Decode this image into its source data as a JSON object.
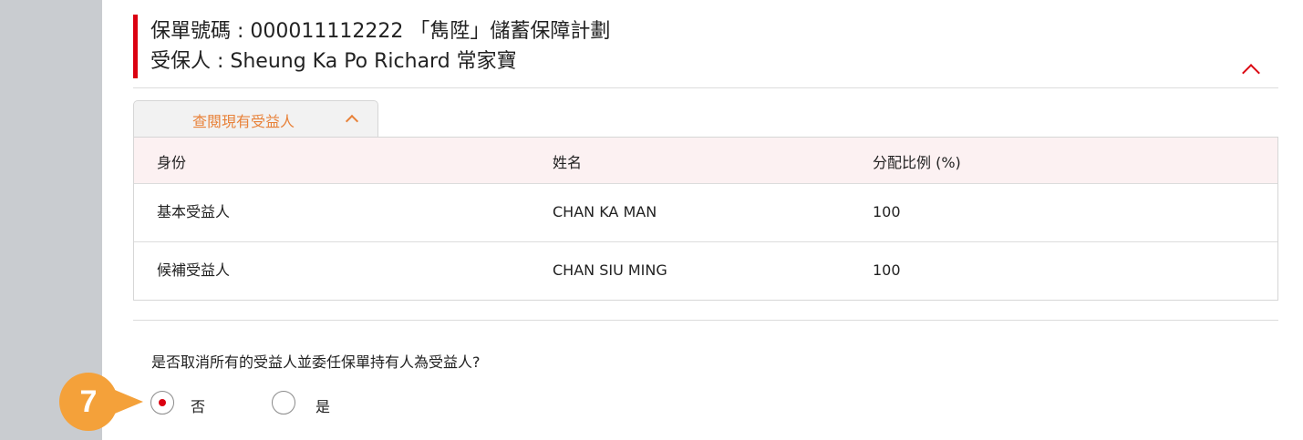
{
  "policy": {
    "line1": "保單號碼 : 000011112222 「雋陞」儲蓄保障計劃",
    "line2": "受保人 : Sheung Ka Po Richard 常家寶",
    "toggle_icon": "chevron-up-icon",
    "accent_color": "#db0011"
  },
  "beneficiary_tab": {
    "label": "查閱現有受益人",
    "icon": "chevron-up-icon",
    "color": "#e8823a"
  },
  "beneficiary_table": {
    "headers": [
      "身份",
      "姓名",
      "分配比例 (%)"
    ],
    "rows": [
      [
        "基本受益人",
        "CHAN KA MAN",
        "100"
      ],
      [
        "候補受益人",
        "CHAN SIU MING",
        "100"
      ]
    ]
  },
  "question": {
    "text": "是否取消所有的受益人並委任保單持有人為受益人?",
    "options": [
      {
        "label": "否",
        "selected": true
      },
      {
        "label": "是",
        "selected": false
      }
    ]
  },
  "step_badge": {
    "number": "7",
    "color": "#f4a13a"
  }
}
